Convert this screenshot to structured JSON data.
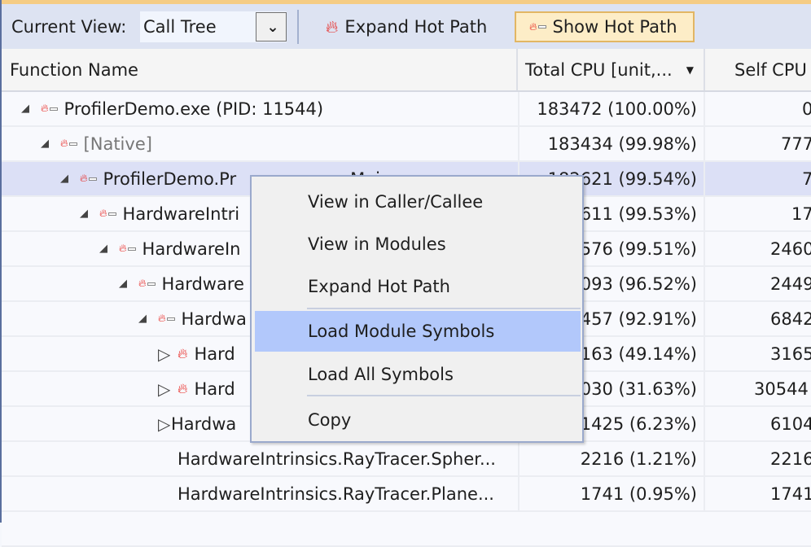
{
  "toolbar": {
    "current_view_label": "Current View:",
    "view_value": "Call Tree",
    "expand_hot_path": "Expand Hot Path",
    "show_hot_path": "Show Hot Path"
  },
  "columns": {
    "function_name": "Function Name",
    "total_cpu": "Total CPU [unit,...",
    "self_cpu": "Self CPU"
  },
  "rows": [
    {
      "name": "ProfilerDemo.exe (PID: 11544)",
      "total": "183472 (100.00%)",
      "self": "0"
    },
    {
      "name": "[Native]",
      "total": "183434 (99.98%)",
      "self": "777"
    },
    {
      "name": "ProfilerDemo.Pr",
      "name_tail": "Mai",
      "total": "182621 (99.54%)",
      "self": "7"
    },
    {
      "name": "HardwareIntri",
      "total": "611 (99.53%)",
      "self": "17"
    },
    {
      "name": "HardwareIn",
      "total": "576 (99.51%)",
      "self": "2460"
    },
    {
      "name": "Hardware",
      "total": "093 (96.52%)",
      "self": "2449"
    },
    {
      "name": "Hardwa",
      "total": "457 (92.91%)",
      "self": "6842"
    },
    {
      "name": "Hard",
      "total": "163 (49.14%)",
      "self": "3165"
    },
    {
      "name": "Hard",
      "total": "030 (31.63%)",
      "self": "30544"
    },
    {
      "name": "Hardwa",
      "total": "1425 (6.23%)",
      "self": "6104"
    },
    {
      "name": "HardwareIntrinsics.RayTracer.Spher...",
      "total": "2216 (1.21%)",
      "self": "2216"
    },
    {
      "name": "HardwareIntrinsics.RayTracer.Plane...",
      "total": "1741 (0.95%)",
      "self": "1741"
    }
  ],
  "context_menu": [
    "View in Caller/Callee",
    "View in Modules",
    "Expand Hot Path",
    "Load Module Symbols",
    "Load All Symbols",
    "Copy"
  ],
  "colors": {
    "hot_flame": "#e8201b",
    "menu_highlight": "#b2c8fb",
    "selected_row": "#dce0f6",
    "show_hot_path_bg": "#fdedc7"
  }
}
